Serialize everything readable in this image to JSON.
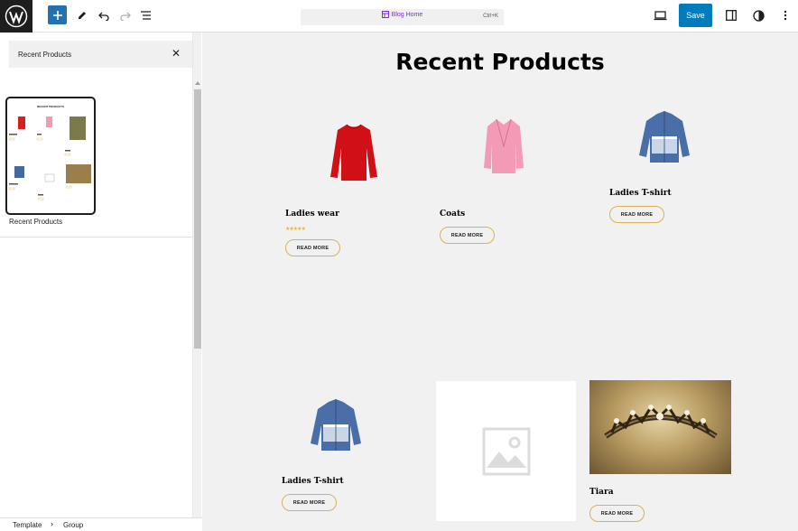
{
  "toolbar": {
    "wp_logo_icon": "wordpress-icon",
    "command_title": "Blog Home",
    "command_shortcut": "Ctrl+K",
    "save_label": "Save"
  },
  "inserter": {
    "search_value": "Recent Products",
    "pattern_label": "Recent Products",
    "thumbnail_title": "RECENT PRODUCTS"
  },
  "canvas": {
    "title": "Recent Products",
    "products": [
      {
        "name": "Ladies wear",
        "button": "READ MORE",
        "rating": "★★★★★"
      },
      {
        "name": "Coats",
        "button": "READ MORE"
      },
      {
        "name": "Ladies T-shirt",
        "button": "READ MORE"
      },
      {
        "name": "Ladies T-shirt",
        "button": "READ MORE"
      },
      {
        "name": "",
        "button": ""
      },
      {
        "name": "Tiara",
        "button": "READ MORE"
      }
    ]
  },
  "breadcrumb": {
    "items": [
      "Template",
      "Group"
    ]
  },
  "colors": {
    "accent": "#007cba",
    "inserter": "#2271b1",
    "canvas": "#f1f1f1",
    "button_border": "#d8b25a",
    "command_text": "#7b2bd8"
  }
}
